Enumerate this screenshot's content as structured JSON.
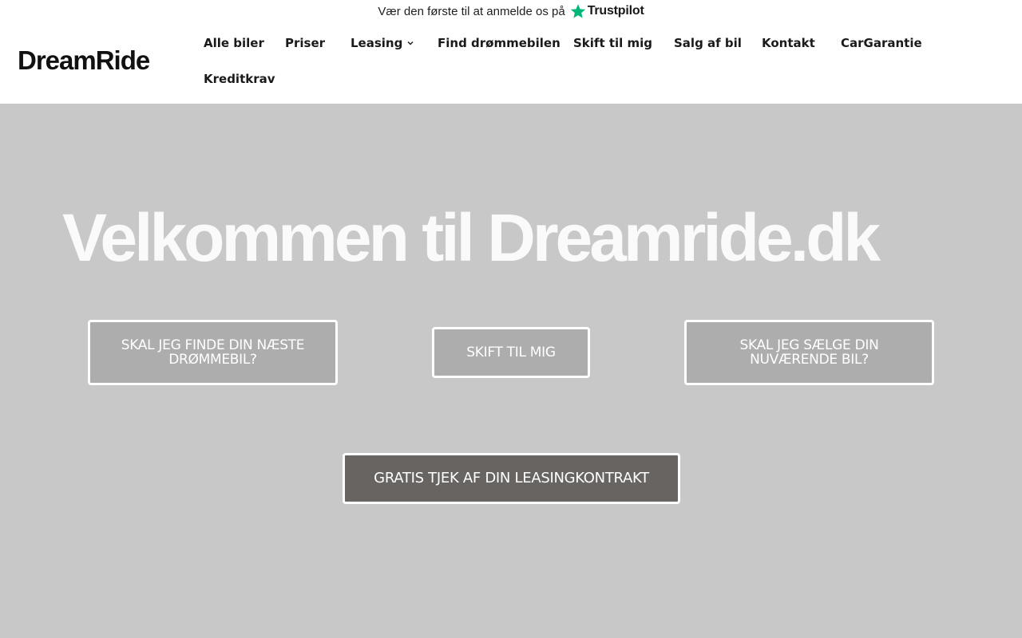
{
  "topbar": {
    "review_text": "Vær den første til at anmelde os på",
    "trustpilot_name": "Trustpilot",
    "star_color": "#00b67a"
  },
  "header": {
    "logo_text": "DreamRide"
  },
  "nav": {
    "items": [
      {
        "label": "Alle biler"
      },
      {
        "label": "Priser"
      },
      {
        "label": "Leasing",
        "has_dropdown": true,
        "icon": "chevron-down-icon"
      },
      {
        "label": "Find drømmebilen"
      },
      {
        "label": "Skift til mig"
      },
      {
        "label": "Salg af bil"
      },
      {
        "label": "Kontakt"
      },
      {
        "label": "CarGarantie"
      },
      {
        "label": "Kreditkrav"
      }
    ]
  },
  "hero": {
    "title": "Velkommen til Dreamride.dk",
    "buttons": {
      "find_car": "SKAL JEG FINDE DIN NÆSTE DRØMMEBIL?",
      "switch": "SKIFT TIL MIG",
      "sell_car": "SKAL JEG SÆLGE DIN NUVÆRENDE BIL?",
      "lease_check": "GRATIS TJEK AF DIN LEASINGKONTRAKT"
    }
  },
  "colors": {
    "hero_bg": "#c8c8c8",
    "button_light": "#adadad",
    "button_dark": "#686462",
    "text_dark": "#1a1a1a"
  }
}
